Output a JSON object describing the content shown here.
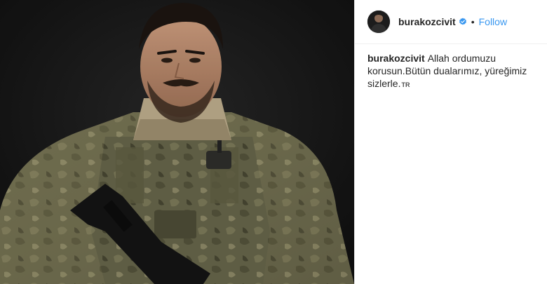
{
  "post": {
    "username": "burakozcivit",
    "follow_label": "Follow",
    "separator": "•",
    "caption_text": "Allah ordumuzu korusun.Bütün dualarımız, yüreğimiz sizlerle.",
    "caption_lang": "TR"
  },
  "colors": {
    "follow": "#3897f0",
    "verified": "#3897f0",
    "photo_background": "#131313"
  },
  "icons": {
    "verified": "verified-badge-icon"
  }
}
